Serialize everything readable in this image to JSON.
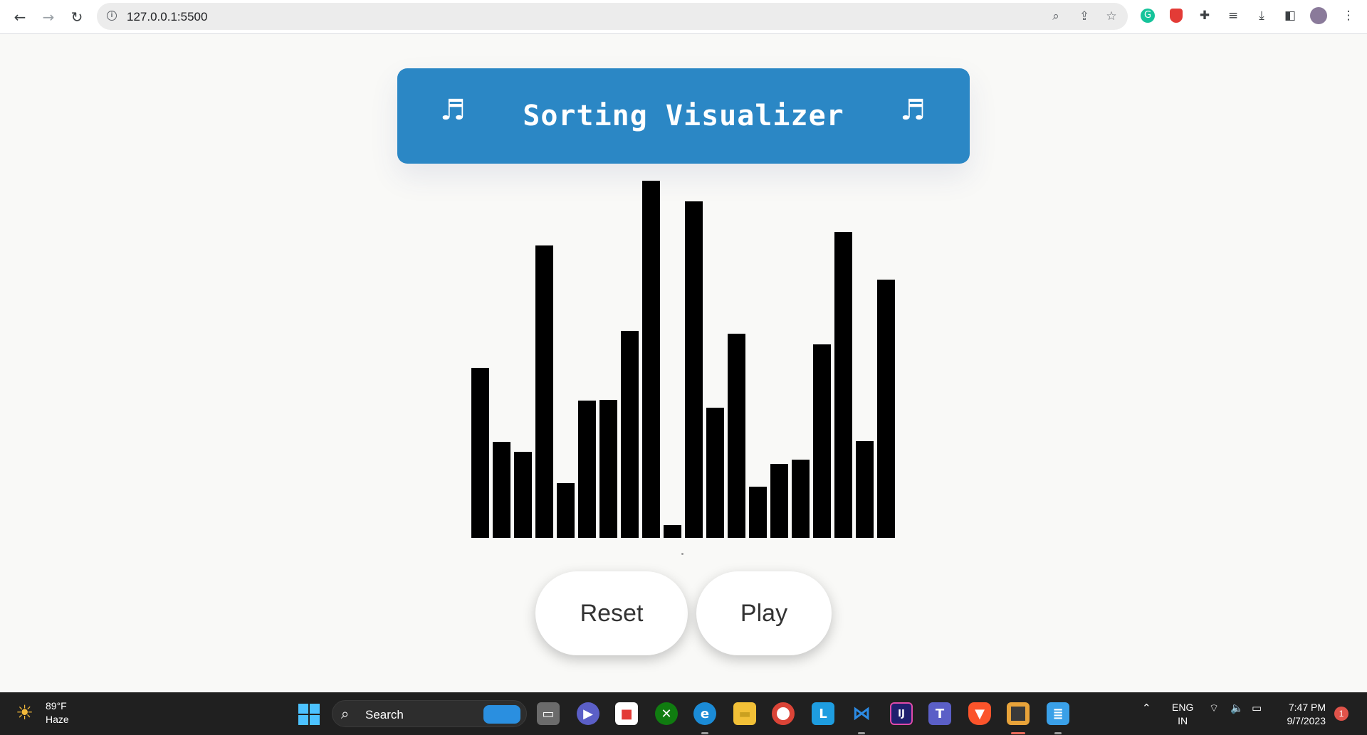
{
  "browser": {
    "url": "127.0.0.1:5500",
    "icons": [
      "back-arrow-icon",
      "forward-arrow-icon",
      "reload-icon",
      "info-icon",
      "zoom-icon",
      "share-icon",
      "star-icon",
      "grammarly-icon",
      "shield-extension-icon",
      "puzzle-extensions-icon",
      "media-controls-icon",
      "download-icon",
      "side-panel-icon",
      "profile-avatar",
      "kebab-menu-icon"
    ]
  },
  "header": {
    "title": "Sorting Visualizer",
    "left_icon": "♬",
    "right_icon": "♬",
    "bg_color": "#2b87c5"
  },
  "chart_data": {
    "type": "bar",
    "bar_color": "#000000",
    "values": [
      236,
      133,
      119,
      405,
      76,
      190,
      191,
      287,
      495,
      18,
      466,
      180,
      283,
      71,
      103,
      108,
      268,
      424,
      134,
      358
    ],
    "ylim": [
      0,
      495
    ]
  },
  "controls": {
    "reset_label": "Reset",
    "play_label": "Play"
  },
  "taskbar": {
    "weather_temp": "89°F",
    "weather_cond": "Haze",
    "search_label": "Search",
    "lang_line1": "ENG",
    "lang_line2": "IN",
    "time": "7:47 PM",
    "date": "9/7/2023",
    "notification_count": "1"
  }
}
